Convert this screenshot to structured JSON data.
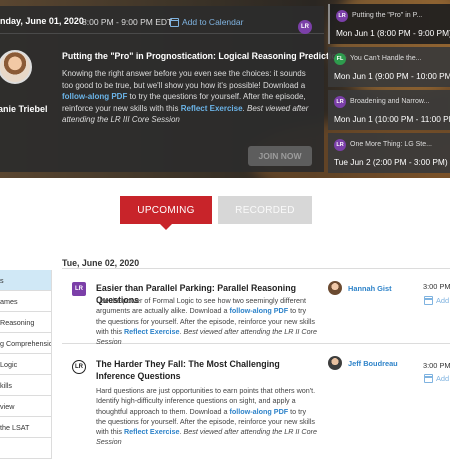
{
  "featured": {
    "date": "nday, June 01, 2020",
    "time": "8:00 PM - 9:00 PM EDT",
    "add_to_calendar": "Add to Calendar",
    "badge": "LR",
    "speaker": "anie Triebel",
    "title": "Putting the \"Pro\" in Prognostication: Logical Reasoning Predictions",
    "desc_1": "Knowing the right answer before you even see the choices: it sounds too good to be true, but we'll show you how it's possible! Download a ",
    "desc_link": "follow-along PDF",
    "desc_2": " to try the questions for yourself. After the episode, reinforce your new skills with this ",
    "desc_link2": "Reflect Exercise",
    "desc_3": ". ",
    "desc_note": "Best viewed after attending the LR III Core Session",
    "join_button": "JOIN NOW"
  },
  "side_sessions": [
    {
      "badge": "LR",
      "badge_color": "#7b3fa8",
      "title": "Putting the \"Pro\" in P...",
      "time": "Mon Jun 1 (8:00 PM - 9:00 PM)"
    },
    {
      "badge": "FL",
      "badge_color": "#2e9b4d",
      "title": "You Can't Handle the...",
      "time": "Mon Jun 1 (9:00 PM - 10:00 PM)"
    },
    {
      "badge": "LR",
      "badge_color": "#7b3fa8",
      "title": "Broadening and Narrow...",
      "time": "Mon Jun 1 (10:00 PM - 11:00 PM)"
    },
    {
      "badge": "LR",
      "badge_color": "#7b3fa8",
      "title": "One More Thing: LG Ste...",
      "time": "Tue Jun 2 (2:00 PM - 3:00 PM)"
    }
  ],
  "tabs": {
    "upcoming": "UPCOMING",
    "recorded": "RECORDED"
  },
  "left_nav": [
    "s",
    "ames",
    "Reasoning",
    "g Comprehension",
    "Logic",
    "kills",
    "view",
    "the LSAT",
    ""
  ],
  "day_header": "Tue, June 02, 2020",
  "events": [
    {
      "badge": "LR",
      "title": "Easier than Parallel Parking: Parallel Reasoning Questions",
      "desc_1": "Use the power of Formal Logic to see how two seemingly different arguments are actually alike. Download a ",
      "desc_link": "follow-along PDF",
      "desc_2": " to try the questions for yourself. After the episode, reinforce your new skills with this ",
      "desc_link2": "Reflect Exercise",
      "desc_3": ". ",
      "desc_note": "Best viewed after attending the LR II Core Session",
      "host": "Hannah Gist",
      "time": "3:00 PM –",
      "add": "Add"
    },
    {
      "badge": "LR",
      "title": "The Harder They Fall: The Most Challenging Inference Questions",
      "desc_1": "Hard questions are just opportunities to earn points that others won't. Identify high-difficulty inference questions on sight, and apply a thoughtful approach to them. Download a ",
      "desc_link": "follow-along PDF",
      "desc_2": " to try the questions for yourself. After the episode, reinforce your new skills with this ",
      "desc_link2": "Reflect Exercise",
      "desc_3": ". ",
      "desc_note": "Best viewed after attending the LR II Core Session",
      "host": "Jeff Boudreau",
      "time": "3:00 PM –",
      "add": "Add"
    }
  ],
  "colors": {
    "accent_red": "#c8242a",
    "link_blue": "#2e83c9",
    "lr_purple": "#7b3fa8"
  }
}
